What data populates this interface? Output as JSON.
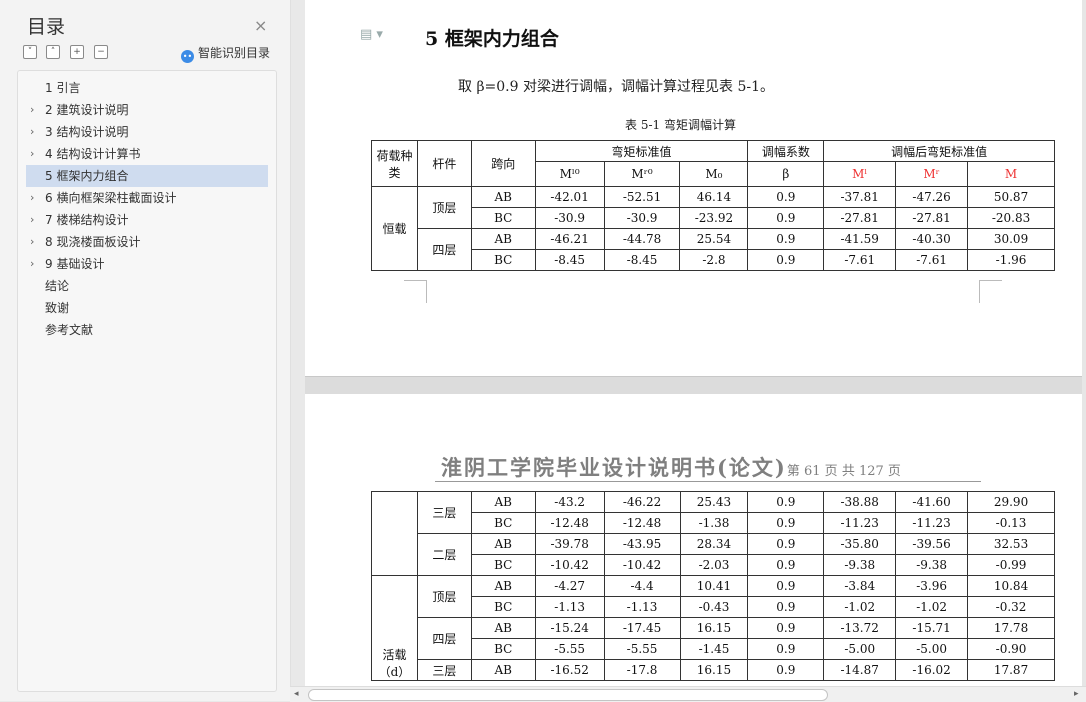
{
  "sidebar": {
    "title": "目录",
    "close_icon": "×",
    "toolbar": {
      "expand_icon": "˅",
      "collapse_icon": "˄",
      "add_icon": "+",
      "remove_icon": "−"
    },
    "smart_toc_label": "智能识别目录",
    "items": [
      {
        "label": "1   引言",
        "expandable": false,
        "active": false
      },
      {
        "label": "2   建筑设计说明",
        "expandable": true,
        "active": false
      },
      {
        "label": "3   结构设计说明",
        "expandable": true,
        "active": false
      },
      {
        "label": "4   结构设计计算书",
        "expandable": true,
        "active": false
      },
      {
        "label": "5  框架内力组合",
        "expandable": false,
        "active": true
      },
      {
        "label": "6  横向框架梁柱截面设计",
        "expandable": true,
        "active": false
      },
      {
        "label": "7   楼梯结构设计",
        "expandable": true,
        "active": false
      },
      {
        "label": "8   现浇楼面板设计",
        "expandable": true,
        "active": false
      },
      {
        "label": "9   基础设计",
        "expandable": true,
        "active": false
      },
      {
        "label": "结论",
        "expandable": false,
        "active": false
      },
      {
        "label": "致谢",
        "expandable": false,
        "active": false
      },
      {
        "label": "参考文献",
        "expandable": false,
        "active": false
      }
    ],
    "chevron": "›"
  },
  "page1": {
    "doc_icon": "▤ ▾",
    "heading": "5  框架内力组合",
    "paragraph": "取 β=0.9 对梁进行调幅，调幅计算过程见表 5-1。",
    "caption": "表 5-1  弯矩调幅计算",
    "table": {
      "h_load": "荷载种类",
      "h_member": "杆件",
      "h_span": "跨向",
      "h_moment_std": "弯矩标准值",
      "h_coef": "调幅系数",
      "h_adjusted": "调幅后弯矩标准值",
      "sub_headers": [
        "Mˡ⁰",
        "Mʳ⁰",
        "M₀",
        "β",
        "Mˡ",
        "Mʳ",
        "M"
      ],
      "load_type": "恒载",
      "groups": [
        {
          "member": "顶层",
          "rows": [
            {
              "span": "AB",
              "values": [
                "-42.01",
                "-52.51",
                "46.14",
                "0.9",
                "-37.81",
                "-47.26",
                "50.87"
              ]
            },
            {
              "span": "BC",
              "values": [
                "-30.9",
                "-30.9",
                "-23.92",
                "0.9",
                "-27.81",
                "-27.81",
                "-20.83"
              ]
            }
          ]
        },
        {
          "member": "四层",
          "rows": [
            {
              "span": "AB",
              "values": [
                "-46.21",
                "-44.78",
                "25.54",
                "0.9",
                "-41.59",
                "-40.30",
                "30.09"
              ]
            },
            {
              "span": "BC",
              "values": [
                "-8.45",
                "-8.45",
                "-2.8",
                "0.9",
                "-7.61",
                "-7.61",
                "-1.96"
              ]
            }
          ]
        }
      ]
    }
  },
  "page2": {
    "header_title": "淮阴工学院毕业设计说明书(论文)",
    "header_page": "第 61 页   共 127 页",
    "live_load_label": "活载（d）",
    "dead_groups": [
      {
        "member": "三层",
        "rows": [
          {
            "span": "AB",
            "values": [
              "-43.2",
              "-46.22",
              "25.43",
              "0.9",
              "-38.88",
              "-41.60",
              "29.90"
            ]
          },
          {
            "span": "BC",
            "values": [
              "-12.48",
              "-12.48",
              "-1.38",
              "0.9",
              "-11.23",
              "-11.23",
              "-0.13"
            ]
          }
        ]
      },
      {
        "member": "二层",
        "rows": [
          {
            "span": "AB",
            "values": [
              "-39.78",
              "-43.95",
              "28.34",
              "0.9",
              "-35.80",
              "-39.56",
              "32.53"
            ]
          },
          {
            "span": "BC",
            "values": [
              "-10.42",
              "-10.42",
              "-2.03",
              "0.9",
              "-9.38",
              "-9.38",
              "-0.99"
            ]
          }
        ]
      }
    ],
    "live_groups": [
      {
        "member": "顶层",
        "rows": [
          {
            "span": "AB",
            "values": [
              "-4.27",
              "-4.4",
              "10.41",
              "0.9",
              "-3.84",
              "-3.96",
              "10.84"
            ]
          },
          {
            "span": "BC",
            "values": [
              "-1.13",
              "-1.13",
              "-0.43",
              "0.9",
              "-1.02",
              "-1.02",
              "-0.32"
            ]
          }
        ]
      },
      {
        "member": "四层",
        "rows": [
          {
            "span": "AB",
            "values": [
              "-15.24",
              "-17.45",
              "16.15",
              "0.9",
              "-13.72",
              "-15.71",
              "17.78"
            ]
          },
          {
            "span": "BC",
            "values": [
              "-5.55",
              "-5.55",
              "-1.45",
              "0.9",
              "-5.00",
              "-5.00",
              "-0.90"
            ]
          }
        ]
      },
      {
        "member": "三层",
        "rows": [
          {
            "span": "AB",
            "values": [
              "-16.52",
              "-17.8",
              "16.15",
              "0.9",
              "-14.87",
              "-16.02",
              "17.87"
            ]
          }
        ]
      }
    ]
  },
  "scrollbar": {
    "left_arrow": "◂",
    "right_arrow": "▸"
  }
}
